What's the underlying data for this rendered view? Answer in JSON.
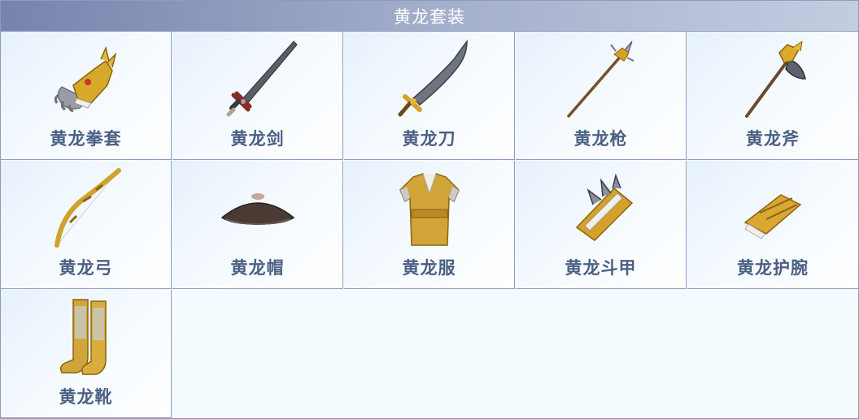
{
  "header": {
    "title": "黄龙套装"
  },
  "items": [
    {
      "label": "黄龙拳套",
      "icon": "gauntlet-icon"
    },
    {
      "label": "黄龙剑",
      "icon": "sword-icon"
    },
    {
      "label": "黄龙刀",
      "icon": "saber-icon"
    },
    {
      "label": "黄龙枪",
      "icon": "spear-icon"
    },
    {
      "label": "黄龙斧",
      "icon": "axe-icon"
    },
    {
      "label": "黄龙弓",
      "icon": "bow-icon"
    },
    {
      "label": "黄龙帽",
      "icon": "hat-icon"
    },
    {
      "label": "黄龙服",
      "icon": "robe-icon"
    },
    {
      "label": "黄龙斗甲",
      "icon": "bracer-armor-icon"
    },
    {
      "label": "黄龙护腕",
      "icon": "wrist-guard-icon"
    },
    {
      "label": "黄龙靴",
      "icon": "boots-icon"
    }
  ]
}
